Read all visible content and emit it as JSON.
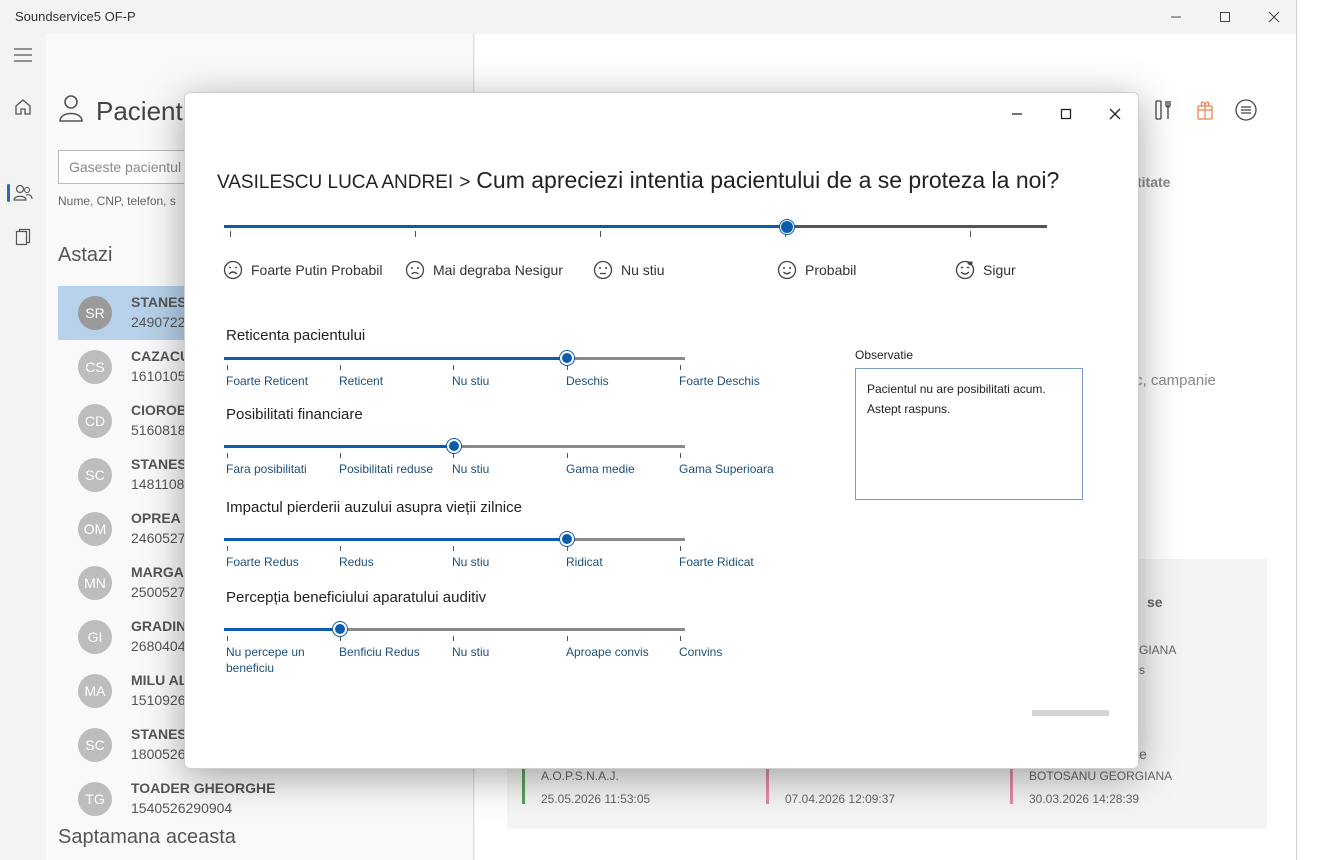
{
  "window": {
    "title": "Soundservice5 OF-P",
    "minimize_glyph": "—",
    "maximize_glyph": "☐",
    "close_glyph": "✕"
  },
  "rail": {
    "icons": [
      "menu-icon",
      "home-icon",
      "patients-icon",
      "documents-icon"
    ]
  },
  "patients": {
    "title": "Pacienti",
    "search_placeholder": "Gaseste pacientul",
    "search_hint": "Nume, CNP, telefon, s",
    "section_today": "Astazi",
    "section_week": "Saptamana aceasta",
    "items": [
      {
        "initials": "SR",
        "name": "STANES",
        "cnp": "2490722",
        "selected": true
      },
      {
        "initials": "CS",
        "name": "CAZACU",
        "cnp": "1610105",
        "selected": false
      },
      {
        "initials": "CD",
        "name": "CIOROB",
        "cnp": "5160818",
        "selected": false
      },
      {
        "initials": "SC",
        "name": "STANES",
        "cnp": "1481108",
        "selected": false
      },
      {
        "initials": "OM",
        "name": "OPREA",
        "cnp": "2460527",
        "selected": false
      },
      {
        "initials": "MN",
        "name": "MARGA",
        "cnp": "2500527",
        "selected": false
      },
      {
        "initials": "GI",
        "name": "GRADIN",
        "cnp": "2680404",
        "selected": false
      },
      {
        "initials": "MA",
        "name": "MILU AL",
        "cnp": "1510926",
        "selected": false
      },
      {
        "initials": "SC",
        "name": "STANES",
        "cnp": "1800526",
        "selected": false
      },
      {
        "initials": "TG",
        "name": "TOADER GHEORGHE",
        "cnp": "1540526290904",
        "selected": false
      }
    ]
  },
  "background": {
    "text_titate": "titate",
    "text_campanie": "c, campanie",
    "text_se": "se",
    "text_giana": "GIANA",
    "text_s": "s",
    "text_e": "e",
    "cards": [
      {
        "name": "A.O.P.S.N.A.J.",
        "date": "25.05.2026 11:53:05",
        "color": "#5aa05a"
      },
      {
        "name": "",
        "date": "07.04.2026 12:09:37",
        "color": "#e58aa6"
      },
      {
        "name": "BOTOSANU GEORGIANA",
        "date": "30.03.2026 14:28:39",
        "color": "#e58aa6"
      }
    ]
  },
  "dialog": {
    "patient": "VASILESCU LUCA ANDREI",
    "separator": ">",
    "question": "Cum apreciezi intentia pacientului de a se proteza la noi?",
    "main_slider": {
      "value": 3,
      "max": 4,
      "moods": [
        {
          "label": "Foarte Putin Probabil",
          "icon": "very-sad-face-icon"
        },
        {
          "label": "Mai degraba Nesigur",
          "icon": "sad-face-icon"
        },
        {
          "label": "Nu stiu",
          "icon": "neutral-face-icon"
        },
        {
          "label": "Probabil",
          "icon": "smile-face-icon"
        },
        {
          "label": "Sigur",
          "icon": "love-face-icon"
        }
      ]
    },
    "sliders": [
      {
        "label": "Reticenta pacientului",
        "value": 3,
        "max": 4,
        "ticks": [
          "Foarte Reticent",
          "Reticent",
          "Nu stiu",
          "Deschis",
          "Foarte Deschis"
        ]
      },
      {
        "label": "Posibilitati financiare",
        "value": 2,
        "max": 4,
        "ticks": [
          "Fara posibilitati",
          "Posibilitati reduse",
          "Nu stiu",
          "Gama medie",
          "Gama Superioara"
        ]
      },
      {
        "label": "Impactul pierderii auzului asupra vieții zilnice",
        "value": 3,
        "max": 4,
        "ticks": [
          "Foarte Redus",
          "Redus",
          "Nu stiu",
          "Ridicat",
          "Foarte Ridicat"
        ]
      },
      {
        "label": "Percepția beneficiului aparatului auditiv",
        "value": 1,
        "max": 4,
        "ticks": [
          "Nu percepe un beneficiu",
          "Benficiu Redus",
          "Nu stiu",
          "Aproape convis",
          "Convins"
        ]
      }
    ],
    "observation_label": "Observatie",
    "observation_text": "Pacientul nu are posibilitati acum. Astept raspuns."
  },
  "colors": {
    "accent": "#0b5cad",
    "track_inactive": "#8a8a8a",
    "selection": "#b7d1ea"
  }
}
